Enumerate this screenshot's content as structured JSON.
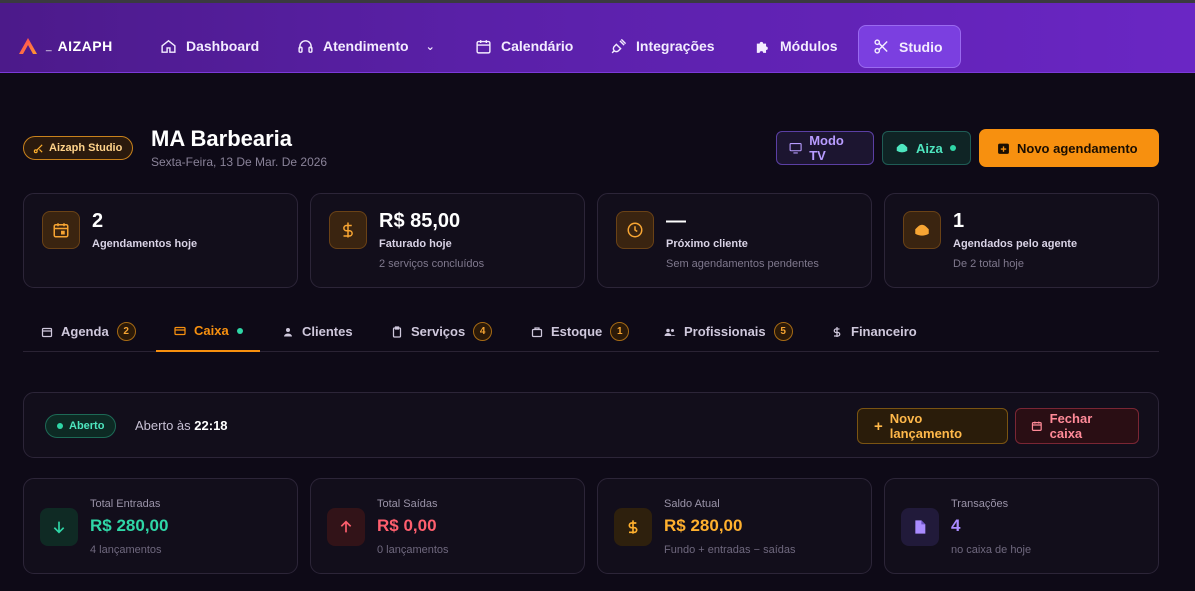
{
  "brand": {
    "name": "AIZAPH",
    "dash": "_"
  },
  "nav": {
    "items": [
      {
        "label": "Dashboard",
        "icon": "home-icon"
      },
      {
        "label": "Atendimento",
        "icon": "headset-icon"
      },
      {
        "label": "Calendário",
        "icon": "calendar-icon"
      },
      {
        "label": "Integrações",
        "icon": "plug-icon"
      },
      {
        "label": "Módulos",
        "icon": "puzzle-icon"
      },
      {
        "label": "Studio",
        "icon": "scissors-icon"
      }
    ],
    "active": "Studio"
  },
  "header": {
    "badge": "Aizaph Studio",
    "title": "MA Barbearia",
    "date": "Sexta-Feira, 13 De Mar. De 2026",
    "buttons": {
      "tv": "Modo TV",
      "aiza": "Aiza",
      "new": "Novo agendamento"
    }
  },
  "stats": [
    {
      "value": "2",
      "label": "Agendamentos hoje",
      "sub": "",
      "icon": "calendar-icon"
    },
    {
      "value": "R$ 85,00",
      "label": "Faturado hoje",
      "sub": "2 serviços concluídos",
      "icon": "dollar-icon"
    },
    {
      "value": "—",
      "label": "Próximo cliente",
      "sub": "Sem agendamentos pendentes",
      "icon": "clock-icon"
    },
    {
      "value": "1",
      "label": "Agendados pelo agente",
      "sub": "De 2 total hoje",
      "icon": "bot-icon"
    }
  ],
  "tabs": [
    {
      "label": "Agenda",
      "badge": "2"
    },
    {
      "label": "Caixa",
      "badge": ""
    },
    {
      "label": "Clientes",
      "badge": ""
    },
    {
      "label": "Serviços",
      "badge": "4"
    },
    {
      "label": "Estoque",
      "badge": "1"
    },
    {
      "label": "Profissionais",
      "badge": "5"
    },
    {
      "label": "Financeiro",
      "badge": ""
    }
  ],
  "caixa": {
    "status": "Aberto",
    "opened_prefix": "Aberto às",
    "opened_time": "22:18",
    "new_entry": "Novo lançamento",
    "close": "Fechar caixa"
  },
  "finance": [
    {
      "label": "Total Entradas",
      "value": "R$ 280,00",
      "sub": "4 lançamentos",
      "color": "#2fd6a6",
      "icon": "arrow-down-icon"
    },
    {
      "label": "Total Saídas",
      "value": "R$ 0,00",
      "sub": "0 lançamentos",
      "color": "#ff5f6e",
      "icon": "arrow-up-icon"
    },
    {
      "label": "Saldo Atual",
      "value": "R$ 280,00",
      "sub": "Fundo + entradas − saídas",
      "color": "#ffb02e",
      "icon": "dollar-icon"
    },
    {
      "label": "Transações",
      "value": "4",
      "sub": "no caixa de hoje",
      "color": "#a98bff",
      "icon": "document-icon"
    }
  ]
}
